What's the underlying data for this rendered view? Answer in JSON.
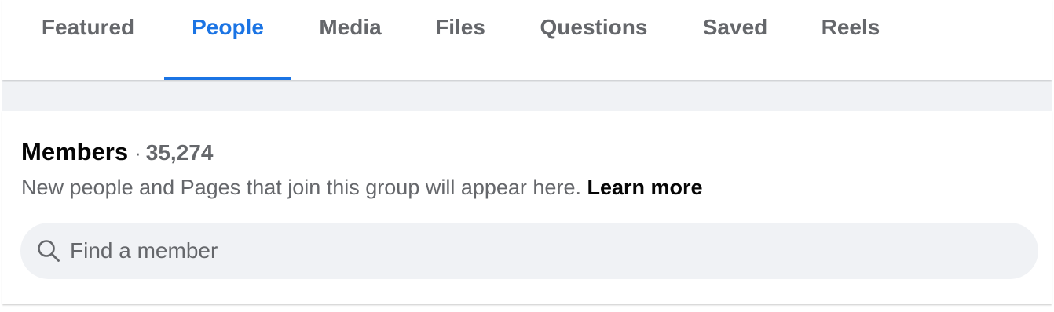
{
  "tabs": [
    {
      "label": "Featured",
      "active": false
    },
    {
      "label": "People",
      "active": true
    },
    {
      "label": "Media",
      "active": false
    },
    {
      "label": "Files",
      "active": false
    },
    {
      "label": "Questions",
      "active": false
    },
    {
      "label": "Saved",
      "active": false
    },
    {
      "label": "Reels",
      "active": false
    }
  ],
  "members": {
    "title": "Members",
    "separator": "·",
    "count": "35,274",
    "description": "New people and Pages that join this group will appear here.",
    "learn_more": "Learn more"
  },
  "search": {
    "placeholder": "Find a member",
    "value": "",
    "icon": "search-icon"
  },
  "colors": {
    "accent": "#1b74e4",
    "secondary_text": "#65676b",
    "primary_text": "#050505",
    "field_background": "#f0f2f5"
  }
}
